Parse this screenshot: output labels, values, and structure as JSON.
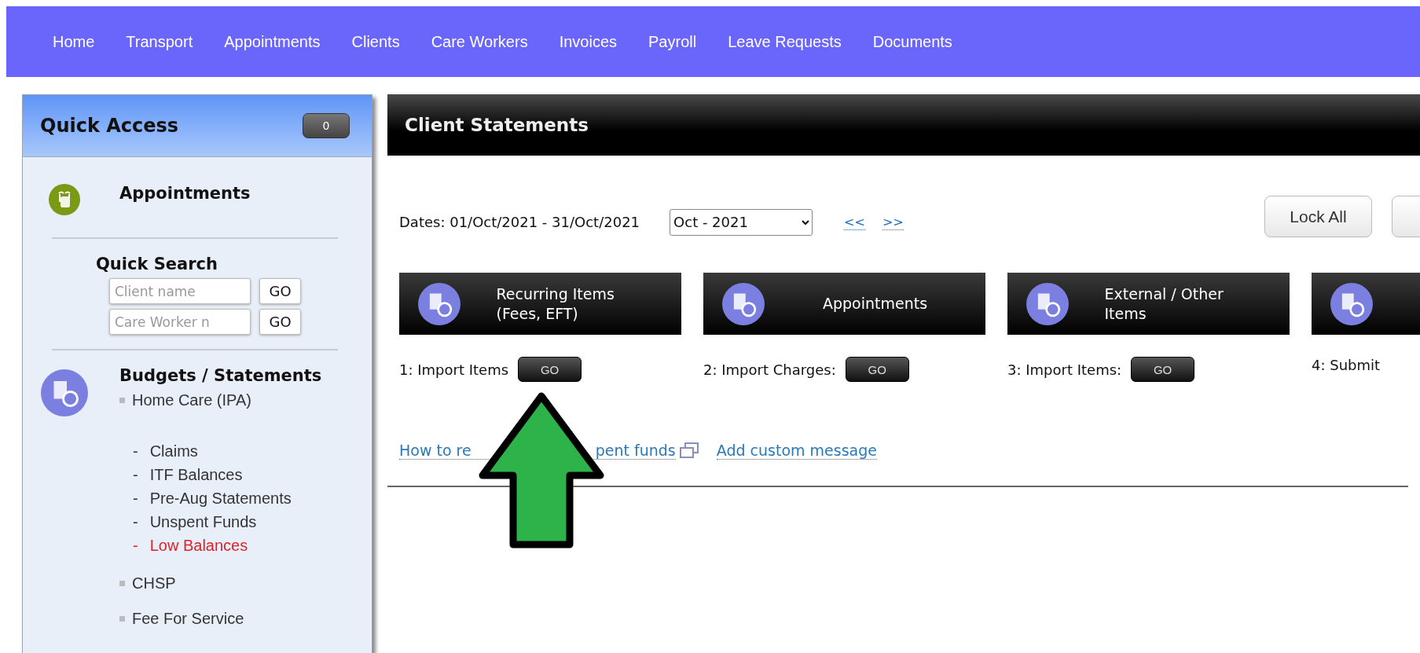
{
  "nav": {
    "items": [
      {
        "label": "Home"
      },
      {
        "label": "Transport"
      },
      {
        "label": "Appointments"
      },
      {
        "label": "Clients"
      },
      {
        "label": "Care Workers"
      },
      {
        "label": "Invoices"
      },
      {
        "label": "Payroll"
      },
      {
        "label": "Leave Requests"
      },
      {
        "label": "Documents"
      }
    ]
  },
  "sidebar": {
    "title": "Quick Access",
    "badge": "0",
    "appointments": {
      "title": "Appointments"
    },
    "quick_search": {
      "title": "Quick Search",
      "fields": [
        {
          "placeholder": "Client name",
          "button": "GO"
        },
        {
          "placeholder": "Care Worker n",
          "button": "GO"
        }
      ]
    },
    "budgets": {
      "title": "Budgets / Statements",
      "items": [
        {
          "label": "Home Care (IPA)",
          "children": [
            {
              "marker": "-",
              "label": "Claims",
              "highlighted": false
            },
            {
              "marker": "-",
              "label": "ITF Balances",
              "highlighted": false
            },
            {
              "marker": "-",
              "label": "Pre-Aug Statements",
              "highlighted": false
            },
            {
              "marker": "-",
              "label": "Unspent Funds",
              "highlighted": false
            },
            {
              "marker": "-",
              "label": "Low Balances",
              "highlighted": true
            }
          ]
        },
        {
          "label": "CHSP"
        },
        {
          "label": "Fee For Service"
        }
      ]
    }
  },
  "main": {
    "title": "Client Statements",
    "dates": "Dates: 01/Oct/2021 - 31/Oct/2021",
    "month": "Oct - 2021",
    "prev": "<<",
    "next": ">>",
    "buttons": [
      {
        "label": "Lock All"
      }
    ],
    "steps": [
      {
        "title": "Recurring Items (Fees, EFT)",
        "label": "1: Import Items",
        "go": "GO"
      },
      {
        "title": "Appointments",
        "label": "2: Import Charges:",
        "go": "GO"
      },
      {
        "title": "External / Other Items",
        "label": "3: Import Items:",
        "go": "GO"
      },
      {
        "label": "4: Submit"
      }
    ],
    "help_link": {
      "visible_parts": [
        "How to re",
        "pent funds"
      ]
    },
    "custom_link": "Add custom message"
  }
}
